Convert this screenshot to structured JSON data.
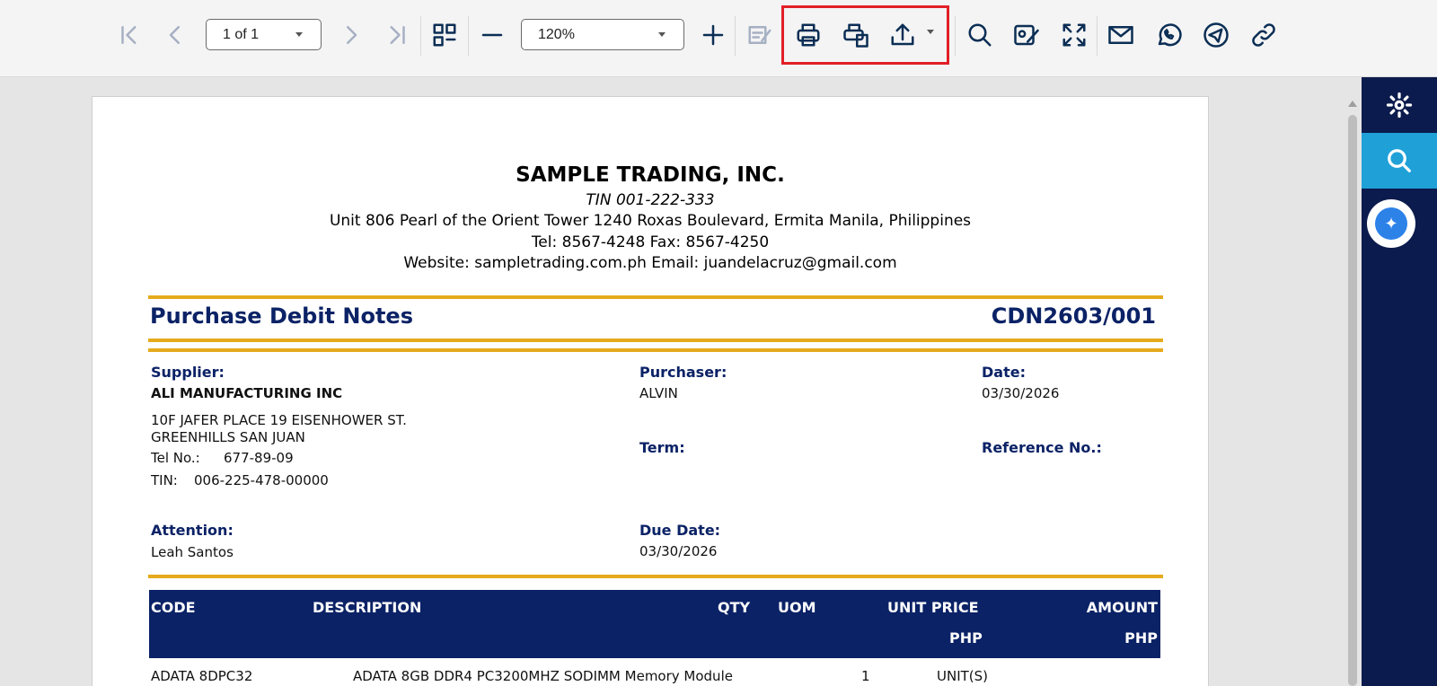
{
  "toolbar": {
    "page_select": "1 of 1",
    "zoom_select": "120%"
  },
  "document": {
    "company_name": "SAMPLE TRADING, INC.",
    "tin": "TIN 001-222-333",
    "address": "Unit 806 Pearl of the Orient Tower 1240 Roxas Boulevard, Ermita Manila, Philippines",
    "telfax": "Tel: 8567-4248  Fax: 8567-4250",
    "web_email": "Website: sampletrading.com.ph  Email: juandelacruz@gmail.com",
    "title": "Purchase Debit Notes",
    "number": "CDN2603/001",
    "supplier_label": "Supplier:",
    "supplier_name": "ALI MANUFACTURING INC",
    "supplier_addr1": "10F JAFER PLACE 19 EISENHOWER ST.",
    "supplier_addr2": "GREENHILLS SAN JUAN",
    "tel_label": "Tel No.:",
    "tel_value": "677-89-09",
    "tin_label": "TIN:",
    "tin_value": "006-225-478-00000",
    "purchaser_label": "Purchaser:",
    "purchaser_value": "ALVIN",
    "date_label": "Date:",
    "date_value": "03/30/2026",
    "term_label": "Term:",
    "reference_label": "Reference No.:",
    "attention_label": "Attention:",
    "attention_value": "Leah Santos",
    "due_label": "Due Date:",
    "due_value": "03/30/2026"
  },
  "table": {
    "headers": {
      "code": "CODE",
      "description": "DESCRIPTION",
      "qty": "QTY",
      "uom": "UOM",
      "unit_price": "UNIT PRICE",
      "unit_price_cur": "PHP",
      "amount": "AMOUNT",
      "amount_cur": "PHP"
    },
    "rows": [
      {
        "code": "ADATA 8DPC32",
        "description": "ADATA 8GB DDR4 PC3200MHZ SODIMM Memory Module",
        "qty": "1",
        "uom": "UNIT(S)"
      }
    ]
  },
  "icons": {
    "first": "first-page-icon",
    "prev": "prev-page-icon",
    "next": "next-page-icon",
    "last": "last-page-icon",
    "thumbs": "thumbnails-icon",
    "zoom_out": "zoom-out-icon",
    "zoom_in": "zoom-in-icon",
    "annotate": "annotate-icon",
    "print": "print-icon",
    "print_alt": "print-options-icon",
    "export": "export-icon",
    "search": "search-icon",
    "sign": "sign-icon",
    "fullscreen": "fullscreen-icon",
    "email": "email-icon",
    "whatsapp": "whatsapp-icon",
    "telegram": "telegram-icon",
    "link": "link-icon",
    "settings": "gear-icon",
    "sidebar_search": "search-icon",
    "assistant": "ai-assistant-icon"
  },
  "colors": {
    "navy": "#0b2266",
    "gold": "#e5aa1d",
    "highlight": "#e21f26",
    "sidebar": "#0b1b4d",
    "sidebar_active": "#1fa1d8"
  }
}
